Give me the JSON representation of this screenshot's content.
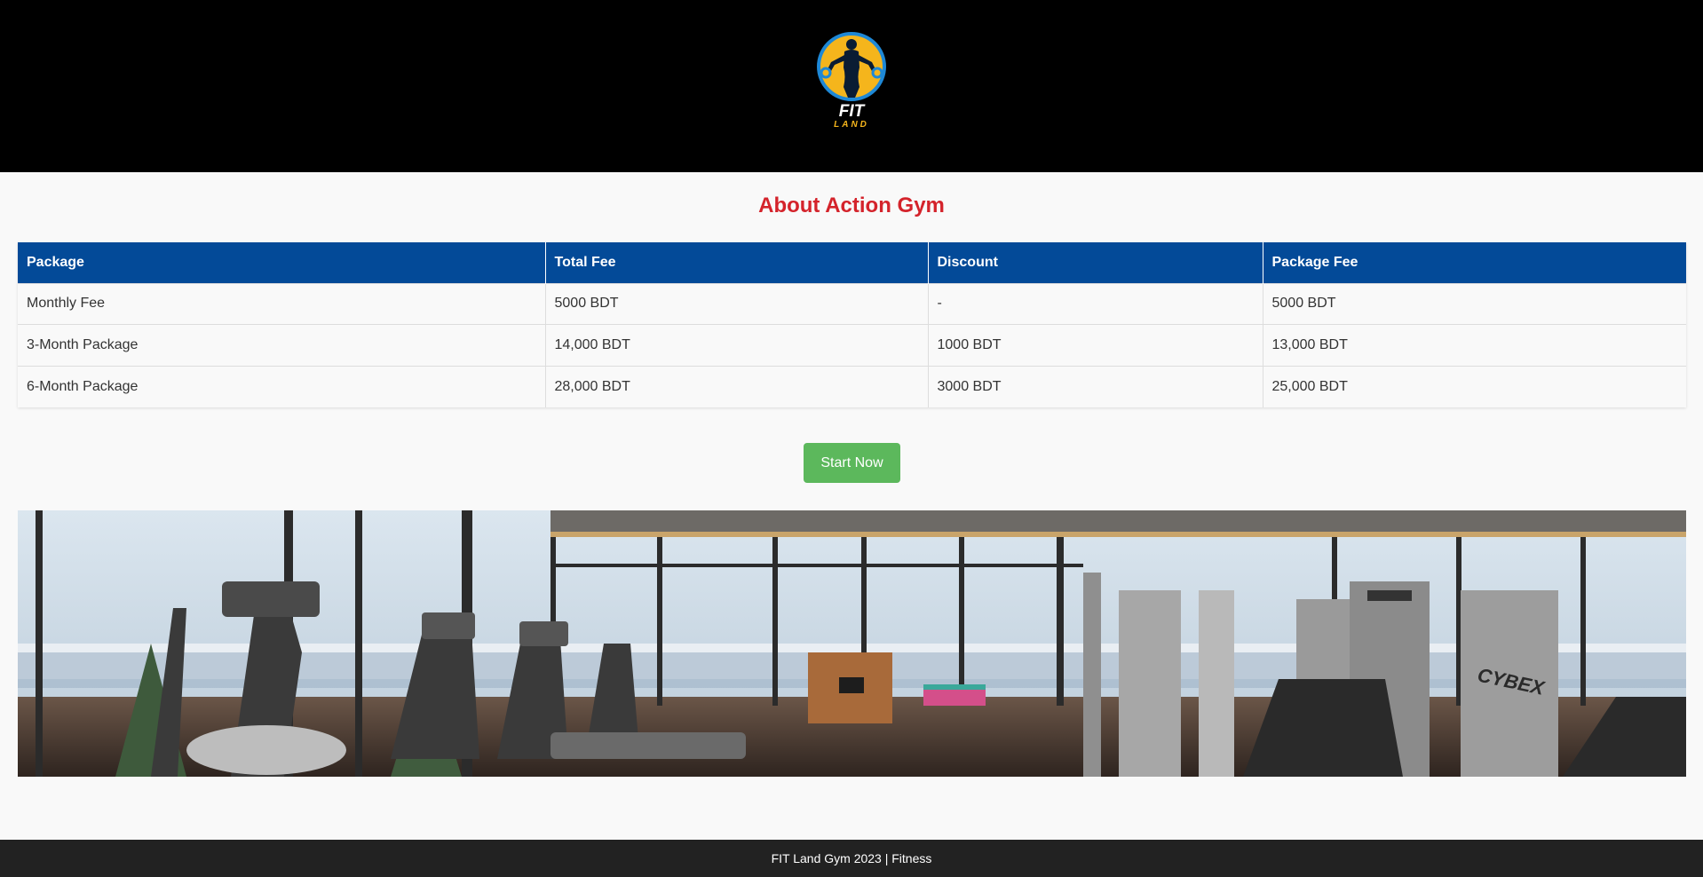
{
  "header": {
    "logo": {
      "name": "FIT LAND",
      "line1": "FIT",
      "line2": "LAND"
    }
  },
  "main": {
    "title": "About Action Gym",
    "table": {
      "headers": [
        "Package",
        "Total Fee",
        "Discount",
        "Package Fee"
      ],
      "rows": [
        [
          "Monthly Fee",
          "5000 BDT",
          "-",
          "5000 BDT"
        ],
        [
          "3-Month Package",
          "14,000 BDT",
          "1000 BDT",
          "13,000 BDT"
        ],
        [
          "6-Month Package",
          "28,000 BDT",
          "3000 BDT",
          "25,000 BDT"
        ]
      ]
    },
    "cta_label": "Start Now",
    "banner": {
      "label": "CYBEX"
    }
  },
  "footer": {
    "text": "FIT Land Gym 2023 | Fitness"
  },
  "colors": {
    "header_bg": "#000000",
    "title": "#d4232b",
    "table_header_bg": "#034a98",
    "cta_bg": "#5cb85c",
    "footer_bg": "#222222",
    "logo_ring": "#1e88d6",
    "logo_fill": "#f5b51c"
  }
}
